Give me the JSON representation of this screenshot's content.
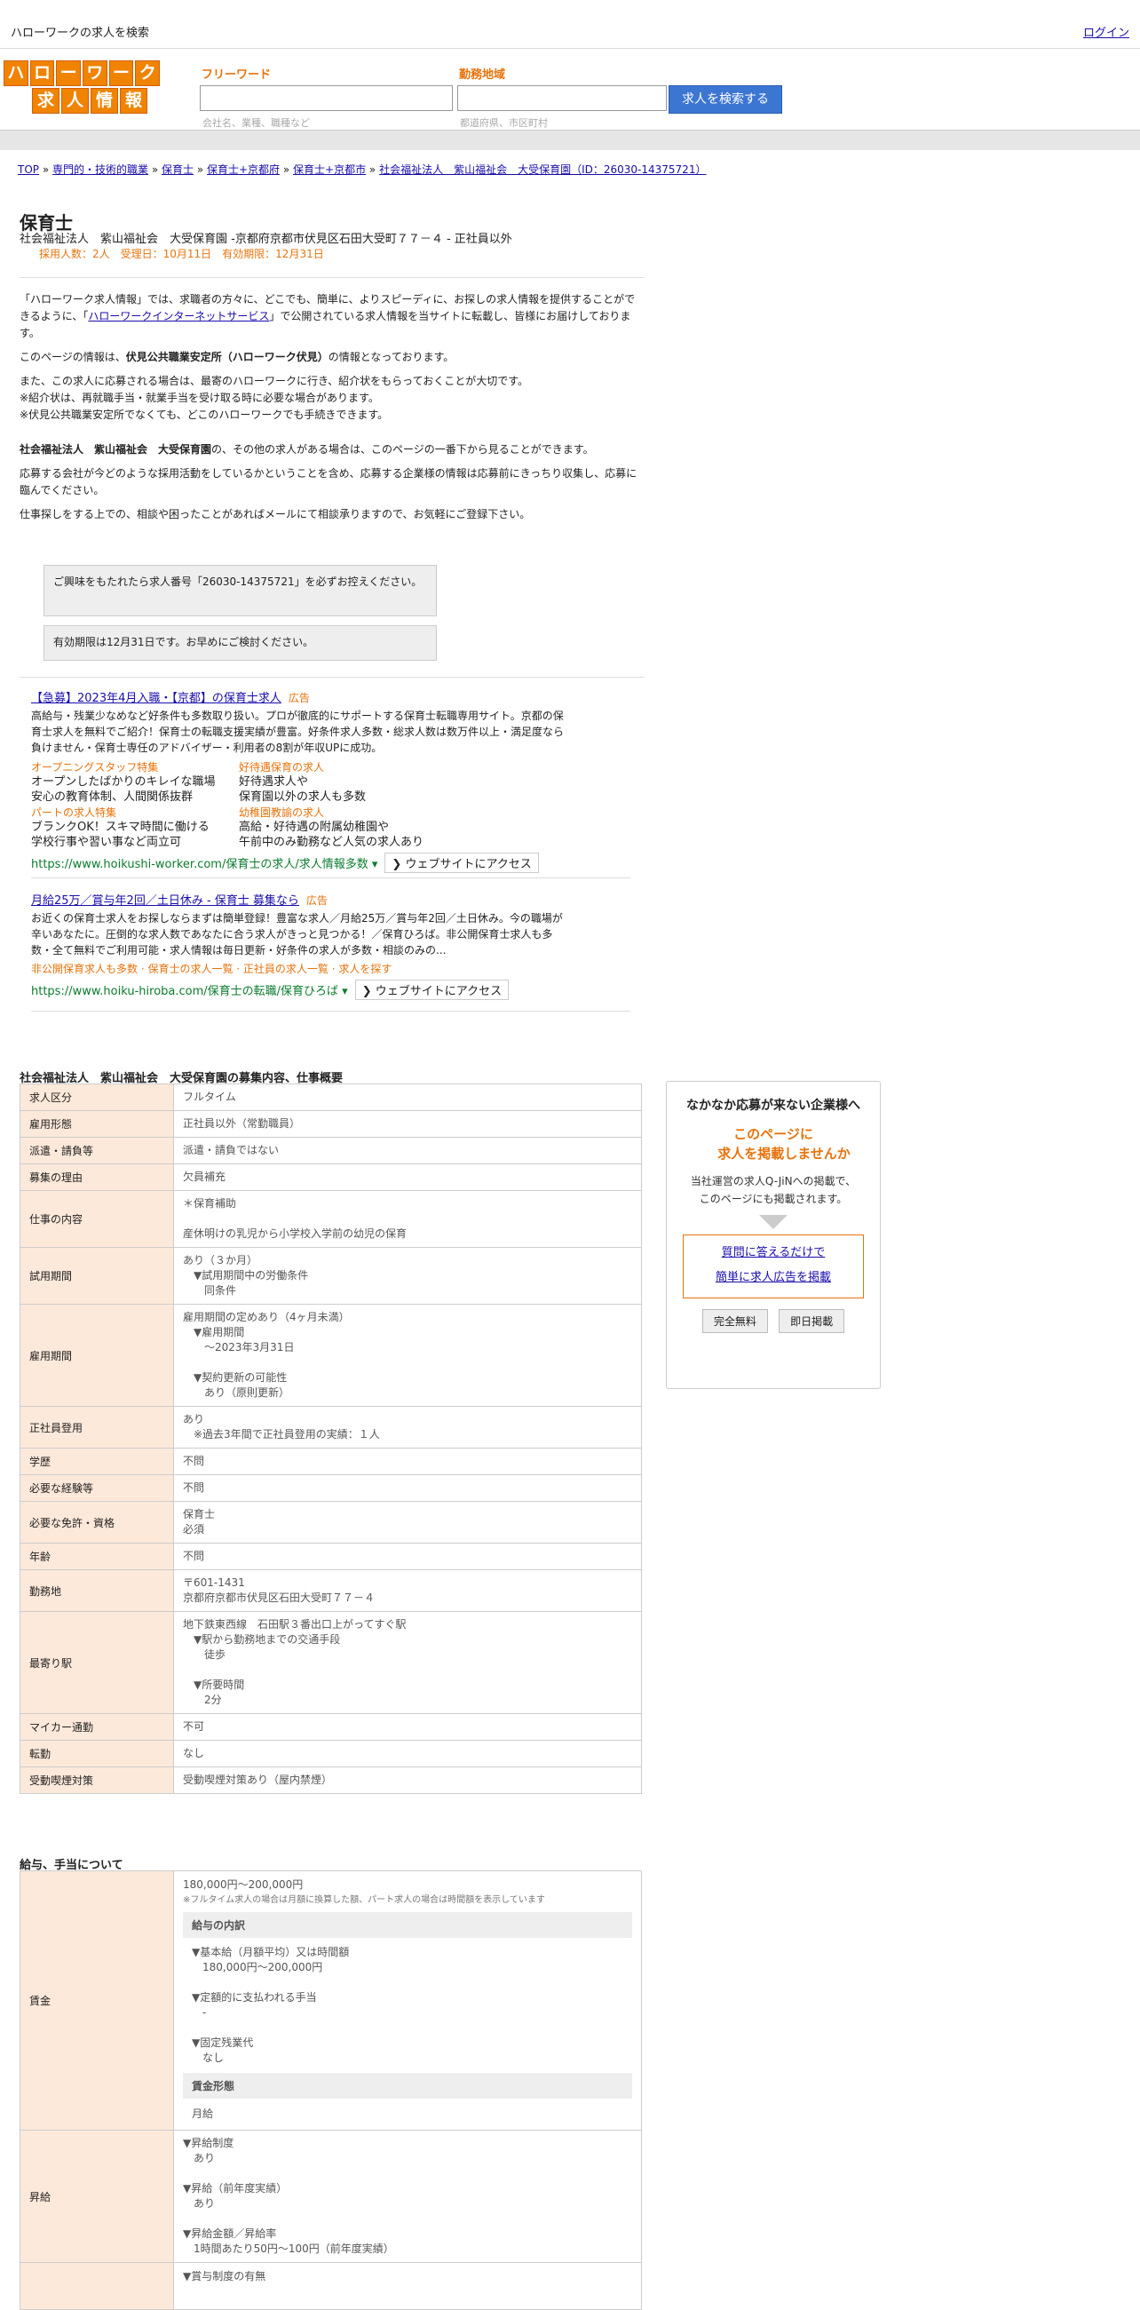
{
  "topbar": {
    "title": "ハローワークの求人を検索",
    "login": "ログイン"
  },
  "logo": {
    "row1": [
      "ハ",
      "ロ",
      "ー",
      "ワ",
      "ー",
      "ク"
    ],
    "row2": [
      "求",
      "人",
      "情",
      "報"
    ]
  },
  "search": {
    "free_label": "フリーワード",
    "free_hint": "会社名、業種、職種など",
    "area_label": "勤務地域",
    "area_hint": "都道府県、市区町村",
    "button": "求人を検索する"
  },
  "breadcrumb": [
    "TOP",
    "専門的・技術的職業",
    "保育士",
    "保育士+京都府",
    "保育士+京都市",
    "社会福祉法人　紫山福祉会　大受保育園（ID：26030-14375721）"
  ],
  "job": {
    "title": "保育士",
    "subtitle": "社会福祉法人　紫山福祉会　大受保育園 -京都府京都市伏見区石田大受町７７－４ - 正社員以外",
    "meta": "採用人数：2人　受理日：10月11日　有効期限：12月31日"
  },
  "intro": {
    "p1a": "「ハローワーク求人情報」では、求職者の方々に、どこでも、簡単に、よりスピーディに、お探しの求人情報を提供することができるように、「",
    "p1link": "ハローワークインターネットサービス",
    "p1b": "」で公開されている求人情報を当サイトに転載し、皆様にお届けしております。",
    "p2a": "このページの情報は、",
    "p2b": "伏見公共職業安定所（ハローワーク伏見）",
    "p2c": "の情報となっております。",
    "p3": "また、この求人に応募される場合は、最寄のハローワークに行き、紹介状をもらっておくことが大切です。",
    "p3b": "※紹介状は、再就職手当・就業手当を受け取る時に必要な場合があります。",
    "p3c": "※伏見公共職業安定所でなくても、どこのハローワークでも手続きできます。",
    "p4a": "社会福祉法人　紫山福祉会　大受保育園",
    "p4b": "の、その他の求人がある場合は、このページの一番下から見ることができます。",
    "p5": "応募する会社が今どのような採用活動をしているかということを含め、応募する企業様の情報は応募前にきっちり収集し、応募に臨んでください。",
    "p6": "仕事探しをする上での、相談や困ったことがあればメールにて相談承りますので、お気軽にご登録下さい。"
  },
  "boxes": {
    "b1": "ご興味をもたれたら求人番号「26030-14375721」を必ずお控えください。",
    "b2": "有効期限は12月31日です。お早めにご検討ください。"
  },
  "ads": [
    {
      "title": "【急募】2023年4月入職・【京都】の保育士求人",
      "tag": "広告",
      "desc": "高給与・残業少なめなど好条件も多数取り扱い。プロが徹底的にサポートする保育士転職専用サイト。京都の保育士求人を無料でご紹介！保育士の転職支援実績が豊富。好条件求人多数・総求人数は数万件以上・満足度なら負けません・保育士専任のアドバイザー・利用者の8割が年収UPに成功。",
      "sitelinks": [
        {
          "h": "オープニングスタッフ特集",
          "d1": "オープンしたばかりのキレイな職場",
          "d2": "安心の教育体制、人間関係抜群"
        },
        {
          "h": "好待遇保育の求人",
          "d1": "好待遇求人や",
          "d2": "保育園以外の求人も多数"
        },
        {
          "h": "パートの求人特集",
          "d1": "ブランクOK！スキマ時間に働ける",
          "d2": "学校行事や習い事など両立可"
        },
        {
          "h": "幼稚園教諭の求人",
          "d1": "高給・好待遇の附属幼稚園や",
          "d2": "午前中のみ勤務など人気の求人あり"
        }
      ],
      "url": "https://www.hoikushi-worker.com/保育士の求人/求人情報多数",
      "button": "ウェブサイトにアクセス"
    },
    {
      "title": "月給25万／賞与年2回／土日休み - 保育士 募集なら",
      "tag": "広告",
      "desc": "お近くの保育士求人をお探しならまずは簡単登録！豊富な求人／月給25万／賞与年2回／土日休み。今の職場が辛いあなたに。圧倒的な求人数であなたに合う求人がきっと見つかる！／保育ひろば。非公開保育士求人も多数・全て無料でご利用可能・求人情報は毎日更新・好条件の求人が多数・相談のみの...",
      "extra": "非公開保育求人も多数 · 保育士の求人一覧 · 正社員の求人一覧 · 求人を探す",
      "url": "https://www.hoiku-hiroba.com/保育士の転職/保育ひろば",
      "button": "ウェブサイトにアクセス"
    }
  ],
  "section1": {
    "title": "社会福祉法人　紫山福祉会　大受保育園の募集内容、仕事概要",
    "rows": [
      {
        "k": "求人区分",
        "v": [
          "フルタイム"
        ]
      },
      {
        "k": "雇用形態",
        "v": [
          "正社員以外（常勤職員）"
        ]
      },
      {
        "k": "派遣・請負等",
        "v": [
          "派遣・請負ではない"
        ]
      },
      {
        "k": "募集の理由",
        "v": [
          "欠員補充"
        ]
      },
      {
        "k": "仕事の内容",
        "v": [
          "＊保育補助",
          "",
          "産休明けの乳児から小学校入学前の幼児の保育"
        ]
      },
      {
        "k": "試用期間",
        "v": [
          "あり（３か月）",
          "　▼試用期間中の労働条件",
          "　　同条件"
        ]
      },
      {
        "k": "雇用期間",
        "v": [
          "雇用期間の定めあり（4ヶ月未満）",
          "　▼雇用期間",
          "　　〜2023年3月31日",
          "",
          "　▼契約更新の可能性",
          "　　あり（原則更新）"
        ]
      },
      {
        "k": "正社員登用",
        "v": [
          "あり",
          "　※過去3年間で正社員登用の実績：１人"
        ]
      },
      {
        "k": "学歴",
        "v": [
          "不問"
        ]
      },
      {
        "k": "必要な経験等",
        "v": [
          "不問"
        ]
      },
      {
        "k": "必要な免許・資格",
        "v": [
          "保育士",
          "必須"
        ]
      },
      {
        "k": "年齢",
        "v": [
          "不問"
        ]
      },
      {
        "k": "勤務地",
        "v": [
          "〒601-1431",
          "京都府京都市伏見区石田大受町７７－４"
        ]
      },
      {
        "k": "最寄り駅",
        "v": [
          "地下鉄東西線　石田駅３番出口上がってすぐ駅",
          "　▼駅から勤務地までの交通手段",
          "　　徒歩",
          "",
          "　▼所要時間",
          "　　2分"
        ]
      },
      {
        "k": "マイカー通勤",
        "v": [
          "不可"
        ]
      },
      {
        "k": "転勤",
        "v": [
          "なし"
        ]
      },
      {
        "k": "受動喫煙対策",
        "v": [
          "受動喫煙対策あり（屋内禁煙）"
        ]
      }
    ]
  },
  "section2": {
    "title": "給与、手当について",
    "wage_k": "賃金",
    "wage_range": "180,000円〜200,000円",
    "wage_note": "※フルタイム求人の場合は月額に換算した額、パート求人の場合は時間額を表示しています",
    "breakdown_head": "給与の内訳",
    "breakdown": [
      "▼基本給（月額平均）又は時間額",
      "　180,000円〜200,000円",
      "",
      "▼定額的に支払われる手当",
      "　-",
      "",
      "▼固定残業代",
      "　なし"
    ],
    "form_head": "賃金形態",
    "form": "月給",
    "raise_k": "昇給",
    "raise": [
      "▼昇給制度",
      "　あり",
      "",
      "▼昇給（前年度実績）",
      "　あり",
      "",
      "▼昇給金額／昇給率",
      "　1時間あたり50円〜100円（前年度実績）"
    ],
    "bonus_first": "▼賞与制度の有無"
  },
  "side": {
    "h1": "なかなか応募が来ない企業様へ",
    "h2a": "このページに",
    "h2b": "求人を掲載しませんか",
    "p1": "当社運営の求人Q-JiNへの掲載で、",
    "p2": "このページにも掲載されます。",
    "link1": "質問に答えるだけで",
    "link2": "簡単に求人広告を掲載",
    "btn1": "完全無料",
    "btn2": "即日掲載"
  },
  "colors": {
    "accent": "#e8730c",
    "logo": "#f08300",
    "search_btn": "#3c76d3",
    "key_bg": "#fde9da",
    "link": "#1a0dab",
    "ad_url": "#0b7c2e"
  }
}
